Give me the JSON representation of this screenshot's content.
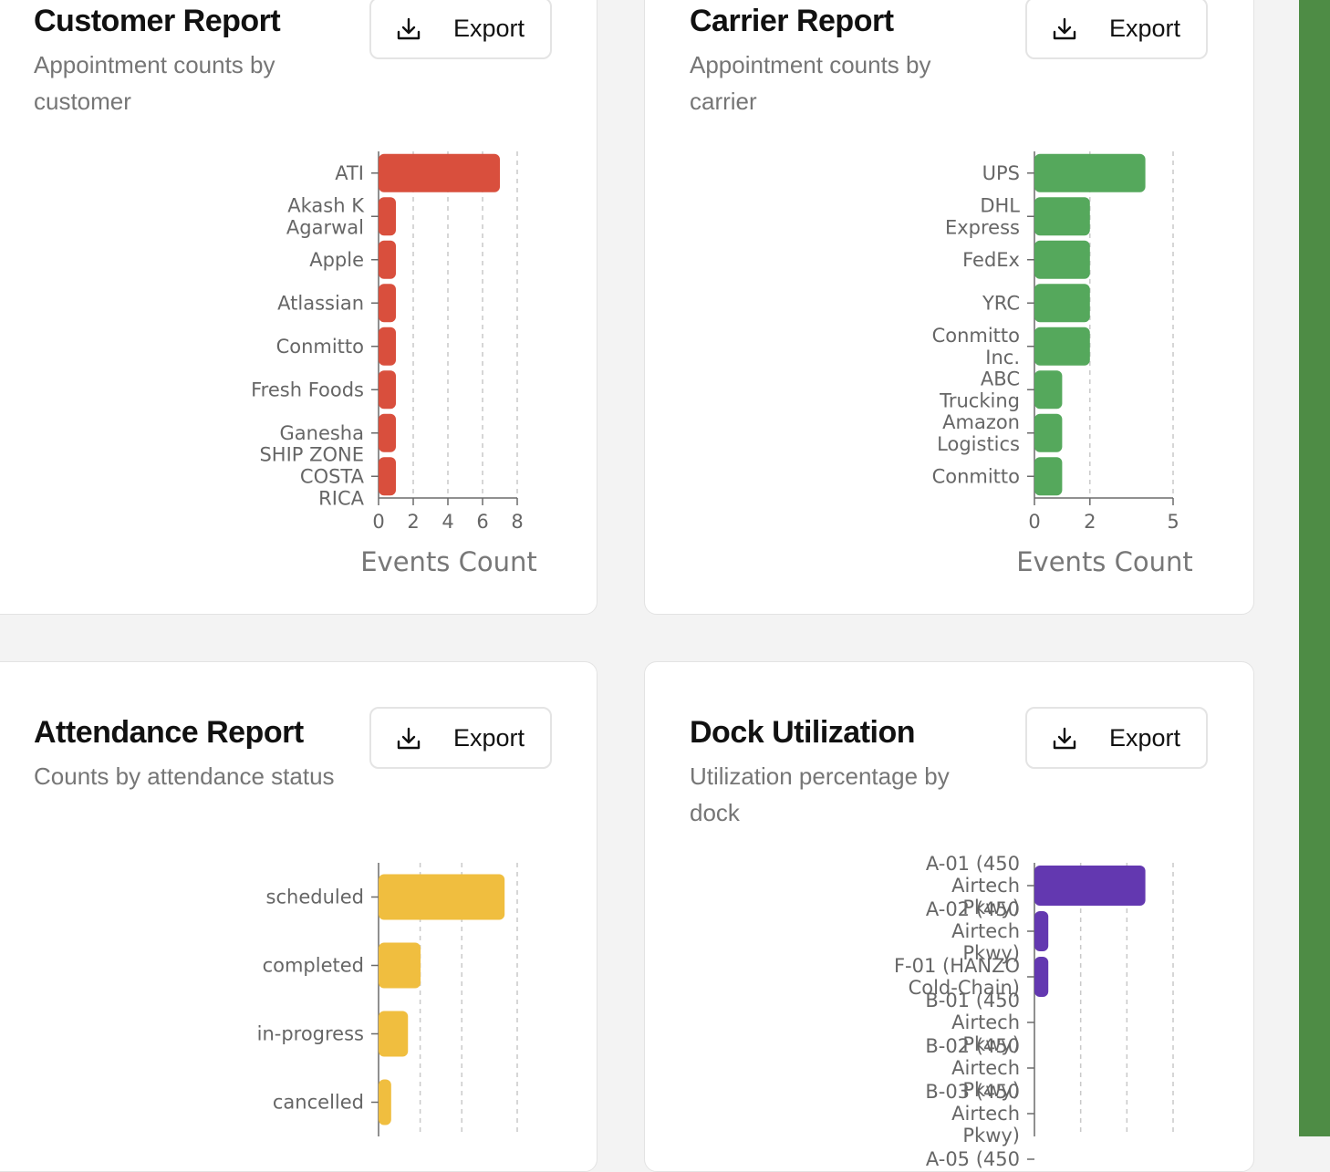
{
  "cards": {
    "customer": {
      "title": "Customer Report",
      "subtitle": "Appointment counts by customer",
      "export_label": "Export"
    },
    "carrier": {
      "title": "Carrier Report",
      "subtitle": "Appointment counts by carrier",
      "export_label": "Export"
    },
    "attendance": {
      "title": "Attendance Report",
      "subtitle": "Counts by attendance status",
      "export_label": "Export"
    },
    "dock": {
      "title": "Dock Utilization",
      "subtitle": "Utilization percentage by dock",
      "export_label": "Export"
    }
  },
  "icons": {
    "export": "download-icon"
  },
  "colors": {
    "customer": "#d94f3d",
    "carrier": "#55a85c",
    "attendance": "#f0be3f",
    "dock": "#6338b0",
    "sidebar_accent": "#4e8c45"
  },
  "chart_data": [
    {
      "type": "bar",
      "orientation": "horizontal",
      "categories": [
        [
          "ATI"
        ],
        [
          "Akash K",
          "Agarwal"
        ],
        [
          "Apple"
        ],
        [
          "Atlassian"
        ],
        [
          "Conmitto"
        ],
        [
          "Fresh Foods"
        ],
        [
          "Ganesha"
        ],
        [
          "SHIP ZONE",
          "COSTA",
          "RICA"
        ]
      ],
      "values": [
        7,
        1,
        1,
        1,
        1,
        1,
        1,
        1
      ],
      "xlabel": "Events Count",
      "xticks": [
        0,
        2,
        4,
        6,
        8
      ],
      "xlim": [
        0,
        8
      ],
      "grid": true
    },
    {
      "type": "bar",
      "orientation": "horizontal",
      "categories": [
        [
          "UPS"
        ],
        [
          "DHL",
          "Express"
        ],
        [
          "FedEx"
        ],
        [
          "YRC"
        ],
        [
          "Conmitto",
          "Inc."
        ],
        [
          "ABC",
          "Trucking"
        ],
        [
          "Amazon",
          "Logistics"
        ],
        [
          "Conmitto"
        ]
      ],
      "values": [
        4,
        2,
        2,
        2,
        2,
        1,
        1,
        1
      ],
      "xlabel": "Events Count",
      "xticks": [
        0,
        2,
        5
      ],
      "xlim": [
        0,
        5
      ],
      "grid": true
    },
    {
      "type": "bar",
      "orientation": "horizontal",
      "categories": [
        [
          "scheduled"
        ],
        [
          "completed"
        ],
        [
          "in-progress"
        ],
        [
          "cancelled"
        ]
      ],
      "values": [
        30,
        10,
        7,
        3
      ],
      "xlim": [
        0,
        33
      ],
      "grid": true
    },
    {
      "type": "bar",
      "orientation": "horizontal",
      "categories": [
        [
          "A-01 (450",
          "Airtech",
          "Pkwy)"
        ],
        [
          "A-02 (450",
          "Airtech",
          "Pkwy)"
        ],
        [
          "F-01 (HANZO",
          "Cold-Chain)"
        ],
        [
          "B-01 (450",
          "Airtech",
          "Pkwy)"
        ],
        [
          "B-02 (450",
          "Airtech",
          "Pkwy)"
        ],
        [
          "B-03 (450",
          "Airtech",
          "Pkwy)"
        ],
        [
          "A-05 (450"
        ]
      ],
      "values": [
        24,
        3,
        3,
        0,
        0,
        0,
        0
      ],
      "xlim": [
        0,
        30
      ],
      "grid": true
    }
  ]
}
